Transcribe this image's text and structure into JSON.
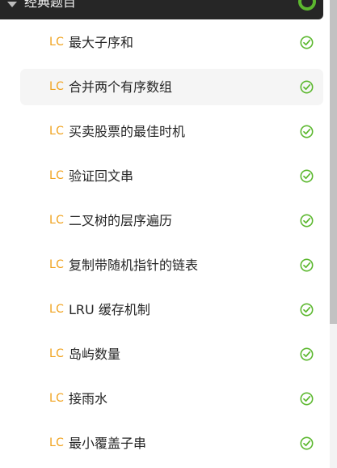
{
  "section": {
    "title": "经典题目",
    "expanded": true,
    "status_color": "#5cb82f"
  },
  "colors": {
    "badge": "#f0a21d",
    "check": "#5cb82f",
    "text": "#262626",
    "active_bg": "#f5f5f5"
  },
  "problems": [
    {
      "badge": "LC",
      "title": "最大子序和",
      "solved": true,
      "active": false
    },
    {
      "badge": "LC",
      "title": "合并两个有序数组",
      "solved": true,
      "active": true
    },
    {
      "badge": "LC",
      "title": "买卖股票的最佳时机",
      "solved": true,
      "active": false
    },
    {
      "badge": "LC",
      "title": "验证回文串",
      "solved": true,
      "active": false
    },
    {
      "badge": "LC",
      "title": "二叉树的层序遍历",
      "solved": true,
      "active": false
    },
    {
      "badge": "LC",
      "title": "复制带随机指针的链表",
      "solved": true,
      "active": false
    },
    {
      "badge": "LC",
      "title": "LRU 缓存机制",
      "solved": true,
      "active": false
    },
    {
      "badge": "LC",
      "title": "岛屿数量",
      "solved": true,
      "active": false
    },
    {
      "badge": "LC",
      "title": "接雨水",
      "solved": true,
      "active": false
    },
    {
      "badge": "LC",
      "title": "最小覆盖子串",
      "solved": true,
      "active": false
    }
  ],
  "icons": {
    "caret": "caret-down-icon",
    "check": "check-circle-icon",
    "status": "progress-ring-icon"
  }
}
